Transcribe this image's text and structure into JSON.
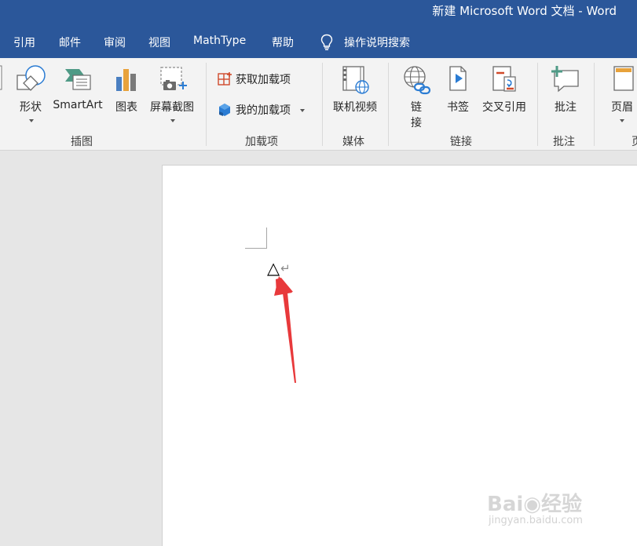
{
  "window": {
    "title": "新建 Microsoft Word 文档  -  Word"
  },
  "tabs": [
    {
      "label": "引用"
    },
    {
      "label": "邮件"
    },
    {
      "label": "审阅"
    },
    {
      "label": "视图"
    },
    {
      "label": "MathType"
    },
    {
      "label": "帮助"
    }
  ],
  "tell_me": {
    "label": "操作说明搜索",
    "icon": "lightbulb-icon"
  },
  "ribbon": {
    "illustrations": {
      "group_label": "插图",
      "shapes_label": "形状",
      "smartart_label": "SmartArt",
      "chart_label": "图表",
      "screenshot_label": "屏幕截图"
    },
    "addins": {
      "group_label": "加载项",
      "get_addins_label": "获取加载项",
      "my_addins_label": "我的加载项"
    },
    "media": {
      "group_label": "媒体",
      "online_video_label": "联机视频"
    },
    "links": {
      "group_label": "链接",
      "link_label_1": "链",
      "link_label_2": "接",
      "bookmark_label": "书签",
      "crossref_label": "交叉引用"
    },
    "comments": {
      "group_label": "批注",
      "comment_label": "批注"
    },
    "header_footer": {
      "header_label": "页眉",
      "group_label_partial": "页"
    }
  },
  "document": {
    "inserted_symbol": "△",
    "paragraph_mark": "↵"
  },
  "watermark": {
    "logo_text": "Bai◉经验",
    "url": "jingyan.baidu.com"
  },
  "colors": {
    "title_bar": "#2b579a",
    "ribbon_bg": "#f3f3f3",
    "canvas_bg": "#e6e6e6",
    "page_bg": "#ffffff",
    "annotation_arrow": "#e8393b"
  }
}
